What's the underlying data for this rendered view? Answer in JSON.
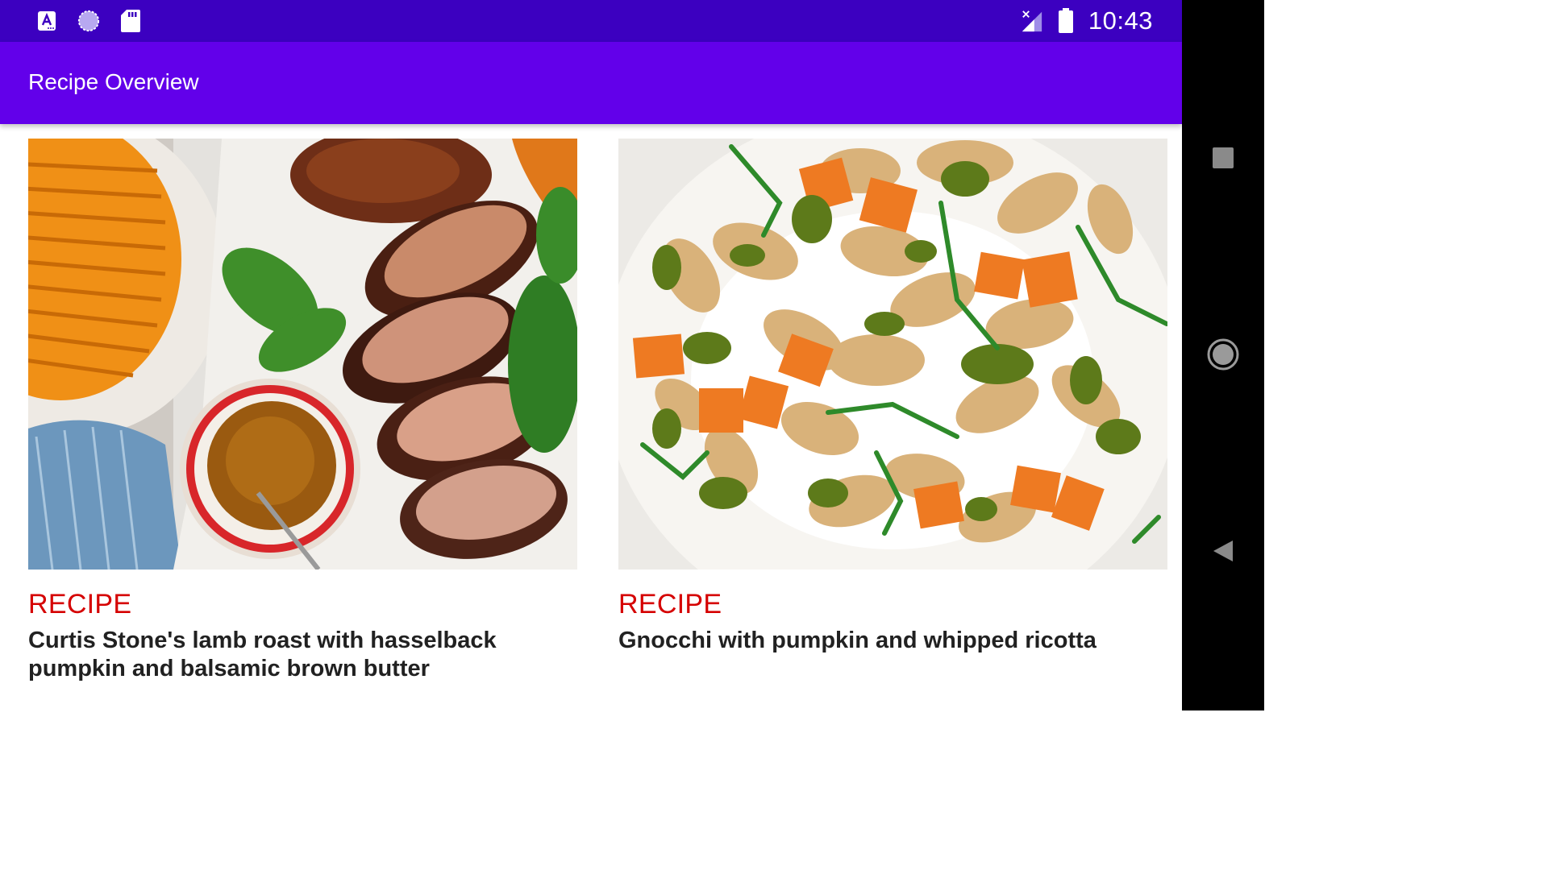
{
  "status_bar": {
    "time": "10:43",
    "left_icons": [
      "accessibility-a-icon",
      "loading-circle-icon",
      "sd-card-icon"
    ],
    "right_icons": [
      "no-signal-icon",
      "battery-icon"
    ]
  },
  "app_bar": {
    "title": "Recipe Overview"
  },
  "recipes": [
    {
      "category": "RECIPE",
      "title": "Curtis Stone's lamb roast with hasselback pumpkin and balsamic brown butter",
      "image": "lamb-roast-photo"
    },
    {
      "category": "RECIPE",
      "title": "Gnocchi with pumpkin and whipped ricotta",
      "image": "gnocchi-photo"
    }
  ],
  "nav_bar": {
    "buttons": [
      "recents-square-icon",
      "home-circle-icon",
      "back-triangle-icon"
    ]
  },
  "colors": {
    "status_bar": "#3c00c0",
    "app_bar": "#6200ea",
    "category_red": "#d50000",
    "title_text": "#212121"
  }
}
